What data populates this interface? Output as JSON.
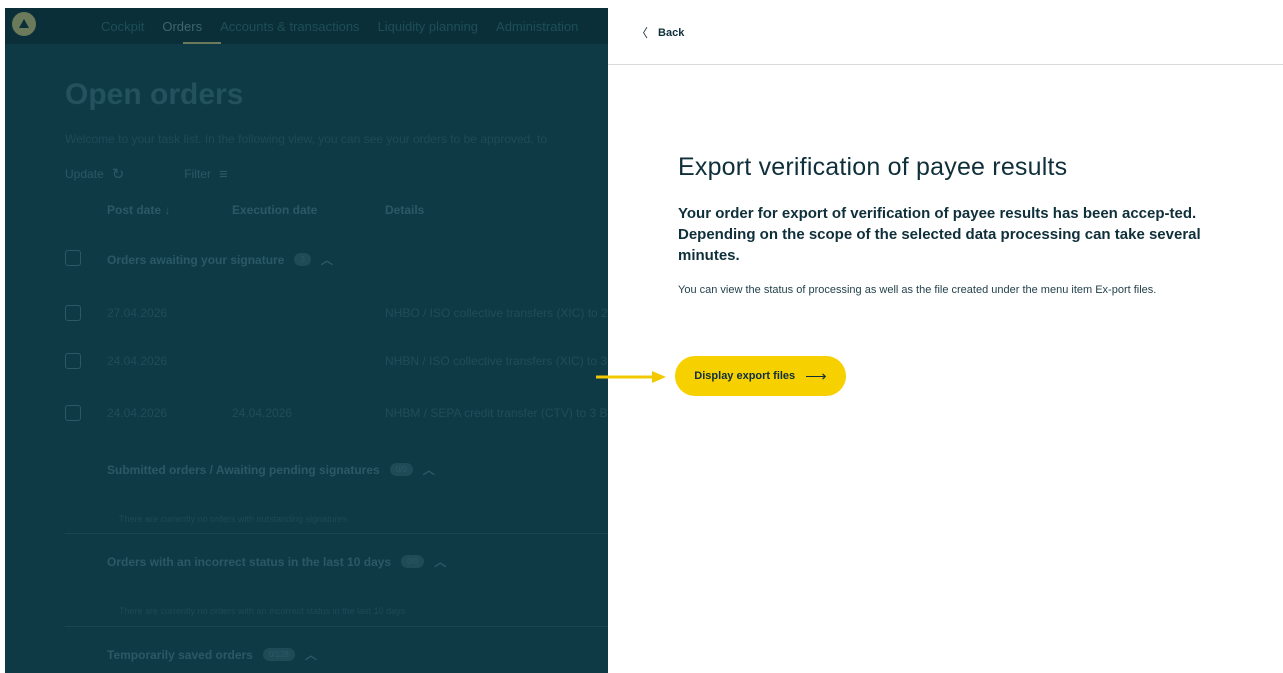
{
  "background_app": {
    "nav": [
      "Cockpit",
      "Orders",
      "Accounts & transactions",
      "Liquidity planning",
      "Administration"
    ],
    "active_nav": "Orders",
    "title": "Open orders",
    "intro": "Welcome to your task list. In the following view, you can see your orders to be approved, to",
    "tools": {
      "update": "Update",
      "filter": "Filter"
    },
    "columns": {
      "post_date": "Post date",
      "execution_date": "Execution date",
      "details": "Details"
    },
    "awaiting_section": {
      "title": "Orders awaiting your signature",
      "badge": "3"
    },
    "rows": [
      {
        "post_date": "27.04.2026",
        "execution_date": "",
        "details": "NHBO / ISO collective transfers (XIC) to 2"
      },
      {
        "post_date": "24.04.2026",
        "execution_date": "",
        "details": "NHBN / ISO collective transfers (XIC) to 3"
      },
      {
        "post_date": "24.04.2026",
        "execution_date": "24.04.2026",
        "details": "NHBM / SEPA credit transfer (CTV) to 3 B"
      }
    ],
    "submitted_section": {
      "title": "Submitted orders / Awaiting pending signatures",
      "badge": "0/0",
      "empty": "There are currently no orders with outstanding signatures"
    },
    "incorrect_section": {
      "title": "Orders with an incorrect status in the last 10 days",
      "badge": "0/0",
      "empty": "There are currently no orders with an incorrect status in the last 10 days"
    },
    "saved_section": {
      "title": "Temporarily saved orders",
      "badge": "0/128"
    }
  },
  "panel": {
    "back_label": "Back",
    "title": "Export verification of payee results",
    "lead": "Your order for export of verification of payee results has been accep-ted. Depending on the scope of the selected data processing can take several minutes.",
    "body": "You can view the status of processing as well as the file created under the menu item Ex-port files.",
    "button_label": "Display export files"
  },
  "colors": {
    "overlay_bg": "#0d3a45",
    "accent_yellow": "#f7d000",
    "text_dark": "#0f2f3a"
  },
  "icons": {
    "back": "chevron-left-icon",
    "button": "arrow-right-icon",
    "update": "refresh-icon",
    "filter": "filter-icon",
    "sort": "arrow-down-icon",
    "callout": "callout-arrow-icon"
  }
}
